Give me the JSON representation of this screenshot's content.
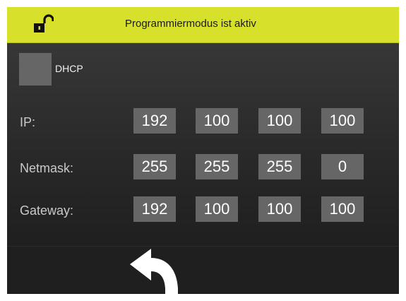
{
  "header": {
    "title": "Programmiermodus ist aktiv",
    "accent_color": "#d7e02a",
    "icon": "unlocked-padlock-icon"
  },
  "dhcp": {
    "label": "DHCP",
    "checked": false
  },
  "network": {
    "rows": [
      {
        "label": "IP:",
        "octets": [
          "192",
          "100",
          "100",
          "100"
        ]
      },
      {
        "label": "Netmask:",
        "octets": [
          "255",
          "255",
          "255",
          "0"
        ]
      },
      {
        "label": "Gateway:",
        "octets": [
          "192",
          "100",
          "100",
          "100"
        ]
      }
    ]
  },
  "footer": {
    "back_icon": "back-arrow-icon"
  }
}
